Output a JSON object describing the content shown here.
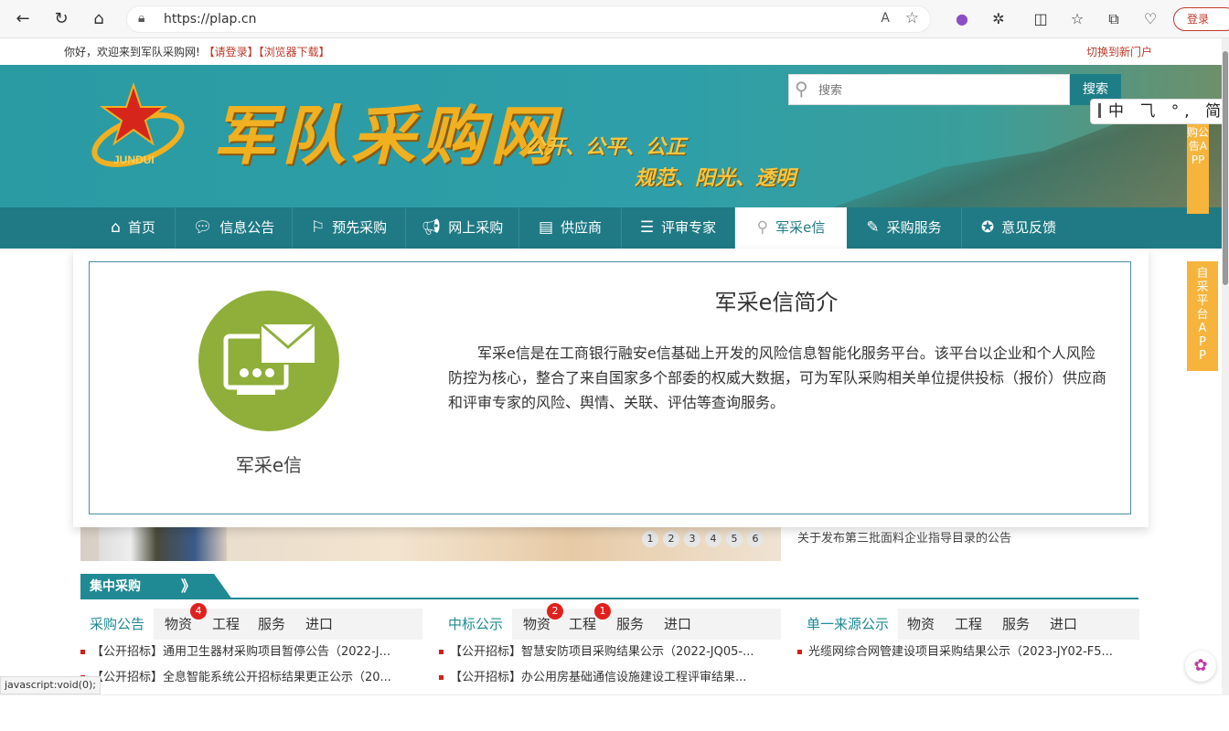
{
  "browser": {
    "url": "https://plap.cn",
    "login_label": "登录",
    "read_aloud": "A",
    "status_text": "javascript:void(0);"
  },
  "topinfo": {
    "greeting": "你好，欢迎来到军队采购网!",
    "login_link": "【请登录】",
    "download_link": "【浏览器下载】",
    "switch_portal": "切换到新门户"
  },
  "banner": {
    "logo_text": "军队采购网",
    "logo_badge": "JUNDUI",
    "slogan_line1": "公开、公平、公正",
    "slogan_line2": "规范、阳光、透明"
  },
  "search": {
    "placeholder": "搜索",
    "button_label": "搜索"
  },
  "ime": {
    "text": "中 ⺄ °, 简"
  },
  "nav": {
    "items": [
      {
        "label": "首页",
        "icon": "home-icon"
      },
      {
        "label": "信息公告",
        "icon": "chat-icon"
      },
      {
        "label": "预先采购",
        "icon": "flag-icon"
      },
      {
        "label": "网上采购",
        "icon": "megaphone-icon"
      },
      {
        "label": "供应商",
        "icon": "document-icon"
      },
      {
        "label": "评审专家",
        "icon": "person-list-icon"
      },
      {
        "label": "军采e信",
        "icon": "search-icon"
      },
      {
        "label": "采购服务",
        "icon": "pen-icon"
      },
      {
        "label": "意见反馈",
        "icon": "award-icon"
      }
    ],
    "active_index": 6
  },
  "side_tabs": {
    "tab1": "购公告APP",
    "tab2": "自采平台APP"
  },
  "popup": {
    "icon_label": "军采e信",
    "title": "军采e信简介",
    "description": "军采e信是在工商银行融安e信基础上开发的风险信息智能化服务平台。该平台以企业和个人风险防控为核心，整合了来自国家多个部委的权威大数据，可为军队采购相关单位提供投标（报价）供应商和评审专家的风险、舆情、关联、评估等查询服务。"
  },
  "slider": {
    "dots": [
      "1",
      "2",
      "3",
      "4",
      "5",
      "6"
    ]
  },
  "news_right": "关于发布第三批面料企业指导目录的公告",
  "section": {
    "title": "集中采购",
    "arrow": "》"
  },
  "columns": [
    {
      "tabs": [
        "采购公告",
        "物资",
        "工程",
        "服务",
        "进口"
      ],
      "badges": {
        "物资": "4"
      },
      "rows": [
        "【公开招标】通用卫生器材采购项目暂停公告（2022-J...",
        "【公开招标】全息智能系统公开招标结果更正公示（20..."
      ]
    },
    {
      "tabs": [
        "中标公示",
        "物资",
        "工程",
        "服务",
        "进口"
      ],
      "badges": {
        "物资": "2",
        "工程": "1"
      },
      "rows": [
        "【公开招标】智慧安防项目采购结果公示（2022-JQ05-...",
        "【公开招标】办公用房基础通信设施建设工程评审结果..."
      ]
    },
    {
      "tabs": [
        "单一来源公示",
        "物资",
        "工程",
        "服务",
        "进口"
      ],
      "badges": {},
      "rows": [
        "光缆网综合网管建设项目采购结果公示（2023-JY02-F5..."
      ]
    }
  ],
  "colors": {
    "teal": "#1f7a85",
    "banner": "#2a9aa3",
    "gold": "#f0b020",
    "red": "#c0392b",
    "green_circle": "#8faf3a",
    "side_tab": "#f6b43c"
  }
}
